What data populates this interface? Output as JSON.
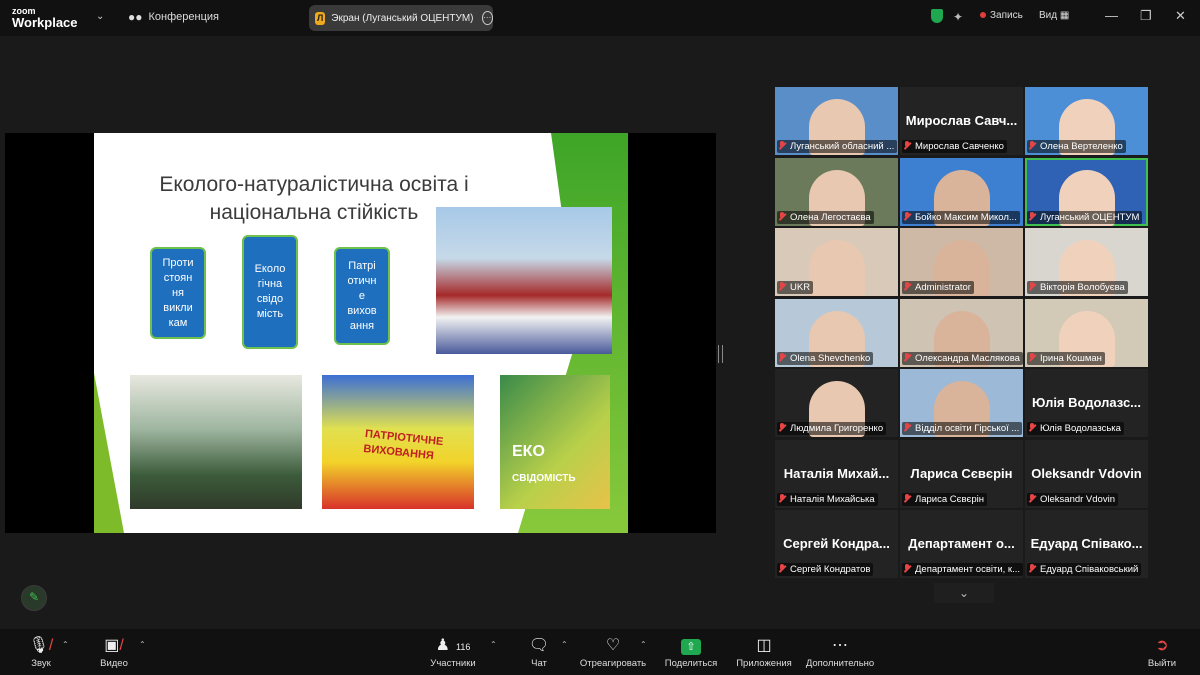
{
  "app": {
    "logo_line1": "zoom",
    "logo_line2": "Workplace",
    "conference_label": "Конференция"
  },
  "share_pill": {
    "initial": "Л",
    "label": "Экран (Луганський ОЦЕНТУМ)"
  },
  "top_right": {
    "record_label": "Запись",
    "view_label": "Вид"
  },
  "slide": {
    "title": "Еколого-натуралістична освіта і національна стійкість",
    "boxes": [
      "Проти\nстоян\nня\nвикли\nкам",
      "Еколо\nгічна\nсвідо\nмість",
      "Патрі\nотичн\nе\nвихов\nання"
    ],
    "photo2_text": "ПАТРІОТИЧНЕ\nВИХОВАННЯ",
    "photo3_text1": "ЕКО",
    "photo3_text2": "СВІДОМІСТЬ"
  },
  "tiles": [
    {
      "big": "",
      "label": "Луганський обласний ...",
      "bg": "#5a8ec9"
    },
    {
      "big": "Мирослав Савч...",
      "label": "Мирослав Савченко",
      "bg": "#232323"
    },
    {
      "big": "",
      "label": "Олена Вертеленко",
      "bg": "#4d8fd6"
    },
    {
      "big": "",
      "label": "Олена Легостаєва",
      "bg": "#6a7a5a"
    },
    {
      "big": "",
      "label": "Бойко Максим Микол...",
      "bg": "#3d7fd0"
    },
    {
      "big": "",
      "label": "Луганський ОЦЕНТУМ",
      "bg": "#2f62b4"
    },
    {
      "big": "",
      "label": "UKR",
      "bg": "#d9c9b9"
    },
    {
      "big": "",
      "label": "Administrator",
      "bg": "#cdb9a6"
    },
    {
      "big": "",
      "label": "Вікторія Волобуєва",
      "bg": "#d9d6d0"
    },
    {
      "big": "",
      "label": "Olena Shevchenko",
      "bg": "#b7c9d8"
    },
    {
      "big": "",
      "label": "Олександра Маслякова",
      "bg": "#cfc4b4"
    },
    {
      "big": "",
      "label": "Ірина Кошман",
      "bg": "#d2c9b6"
    },
    {
      "big": "",
      "label": "Людмила Григоренко",
      "bg": "#232323"
    },
    {
      "big": "",
      "label": "Відділ освіти Гірської ...",
      "bg": "#9cb9d8"
    },
    {
      "big": "Юлія Водолазс...",
      "label": "Юлія Водолазська",
      "bg": "#232323"
    },
    {
      "big": "Наталія Михай...",
      "label": "Наталія Михайська",
      "bg": "#232323"
    },
    {
      "big": "Лариса Сєвєрін",
      "label": "Лариса Сєвєрін",
      "bg": "#232323"
    },
    {
      "big": "Oleksandr Vdovin",
      "label": "Oleksandr Vdovin",
      "bg": "#232323"
    },
    {
      "big": "Сергей Кондра...",
      "label": "Сергей Кондратов",
      "bg": "#232323"
    },
    {
      "big": "Департамент о...",
      "label": "Департамент освіти, к...",
      "bg": "#232323"
    },
    {
      "big": "Едуард Співако...",
      "label": "Едуард Співаковський",
      "bg": "#232323"
    }
  ],
  "toolbar": {
    "audio": "Звук",
    "video": "Видео",
    "participants": "Участники",
    "participants_count": "116",
    "chat": "Чат",
    "react": "Отреагировать",
    "share": "Поделиться",
    "apps": "Приложения",
    "more": "Дополнительно",
    "leave": "Выйти"
  }
}
